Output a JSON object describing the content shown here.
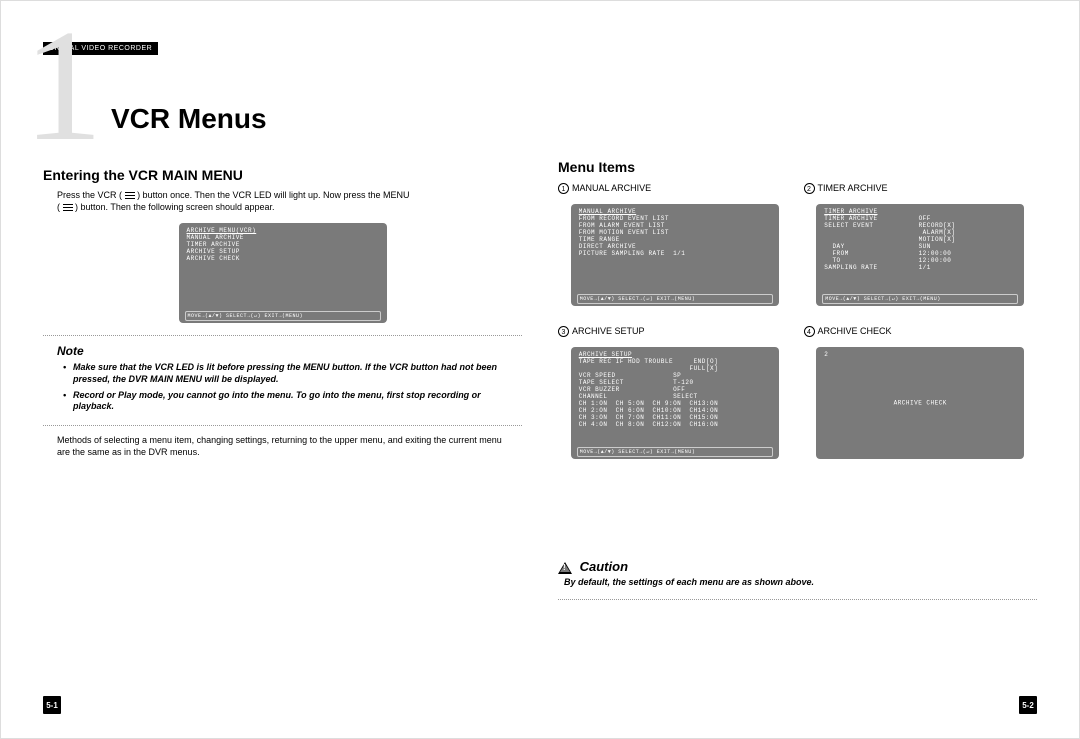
{
  "header_tab": "DIGITAL VIDEO RECORDER",
  "chapter_number": "1",
  "chapter_title": "VCR Menus",
  "left": {
    "section_heading": "Entering the VCR MAIN MENU",
    "intro_a": "Press the VCR (",
    "intro_b": ") button once. Then the VCR LED will light up. Now press the MENU",
    "intro_c": "(",
    "intro_d": ") button. Then the following screen should appear.",
    "screen": {
      "title": "ARCHIVE MENU(VCR)",
      "items": [
        "MANUAL ARCHIVE",
        "TIMER ARCHIVE",
        "ARCHIVE SETUP",
        "ARCHIVE CHECK"
      ],
      "footer": "MOVE→(▲/▼) SELECT→(↵) EXIT→(MENU)"
    },
    "note_title": "Note",
    "note_items": [
      "Make sure that the VCR LED is lit before pressing the MENU button. If the VCR button had not been pressed, the DVR MAIN MENU will be displayed.",
      "Record or Play mode, you cannot go into the menu. To go into the menu, first stop recording or playback."
    ],
    "methods_text": "Methods of selecting a menu item, changing settings, returning to the upper menu, and exiting the current menu are the same as in the DVR menus."
  },
  "right": {
    "section_heading": "Menu Items",
    "items": [
      {
        "num": "①",
        "label": "MANUAL ARCHIVE",
        "screen": {
          "title": "MANUAL ARCHIVE",
          "lines": [
            "FROM RECORD EVENT LIST",
            "FROM ALARM EVENT LIST",
            "FROM MOTION EVENT LIST",
            "TIME RANGE",
            "DIRECT ARCHIVE",
            "PICTURE SAMPLING RATE  1/1"
          ],
          "footer": "MOVE→(▲/▼) SELECT→(↵) EXIT→(MENU)"
        }
      },
      {
        "num": "②",
        "label": "TIMER ARCHIVE",
        "screen": {
          "title": "TIMER ARCHIVE",
          "lines": [
            "TIMER ARCHIVE          OFF",
            "SELECT EVENT           RECORD[X]",
            "                        ALARM[X]",
            "                       MOTION[X]",
            "  DAY                  SUN",
            "  FROM                 12:00:00",
            "  TO                   12:00:00",
            "SAMPLING RATE          1/1"
          ],
          "footer": "MOVE→(▲/▼) SELECT→(↵) EXIT→(MENU)"
        }
      },
      {
        "num": "③",
        "label": "ARCHIVE SETUP",
        "screen": {
          "title": "ARCHIVE SETUP",
          "lines": [
            "TAPE REC IF HDD TROUBLE     END[O]",
            "                           FULL[X]",
            "VCR SPEED              SP",
            "TAPE SELECT            T-120",
            "VCR BUZZER             OFF",
            "CHANNEL                SELECT",
            "CH 1:ON  CH 5:ON  CH 9:ON  CH13:ON",
            "CH 2:ON  CH 6:ON  CH10:ON  CH14:ON",
            "CH 3:ON  CH 7:ON  CH11:ON  CH15:ON",
            "CH 4:ON  CH 8:ON  CH12:ON  CH16:ON"
          ],
          "footer": "MOVE→(▲/▼) SELECT→(↵) EXIT→(MENU)"
        }
      },
      {
        "num": "④",
        "label": "ARCHIVE CHECK",
        "screen": {
          "title": "2",
          "center": "ARCHIVE CHECK"
        }
      }
    ],
    "caution_title": "Caution",
    "caution_text": "By default, the settings of each menu are as shown above."
  },
  "page_left_num": "5-1",
  "page_right_num": "5-2"
}
